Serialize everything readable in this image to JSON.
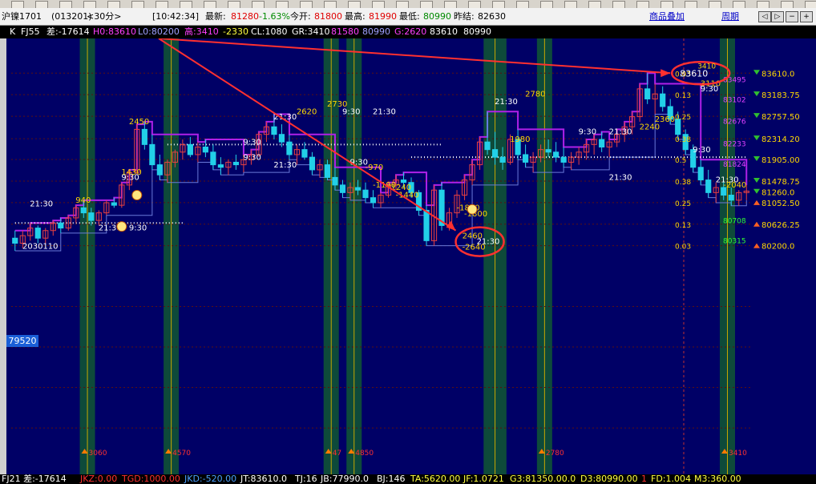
{
  "quote_bar": {
    "symbol": "沪镍1701",
    "code": "(013201)",
    "period": "<30分>",
    "time": "[10:42:34]",
    "latest_label": "最新:",
    "latest": "81280",
    "change": "-1.63%",
    "open_label": "今开:",
    "open": "81800",
    "high_label": "最高:",
    "high": "81990",
    "low_label": "最低:",
    "low": "80990",
    "prev_close_label": "昨结:",
    "prev_close": "82630",
    "overlay_link": "商品叠加",
    "period_link": "周期"
  },
  "indicator_bar": {
    "k": "K",
    "name": "FJ55",
    "diff": "差:-17614",
    "h0": "H0:83610",
    "l0": "L0:80200",
    "high": "高:3410",
    "neg": "-2330",
    "cl": "CL:1080",
    "gr": "GR:3410",
    "v1": "81580",
    "v2": "80990",
    "g": "G:2620",
    "v3": "83610",
    "v4": "80990"
  },
  "status_bar": {
    "a": "FJ21 差:-17614",
    "b": "JKZ:0.00",
    "c": "TGD:1000.00",
    "d": "JKD:-520.00",
    "e": "JT:83610.0",
    "f": "TJ:16",
    "g": "JB:77990.0",
    "h": "BJ:146",
    "i": "TA:5620.00",
    "j": "JF:1.0721",
    "k": "G3:81350.00.0",
    "l": "D3:80990.00",
    "m": "1",
    "n": "FD:1.004",
    "o": "M3:360.00"
  },
  "highlight_price": "79520",
  "colors": {
    "bg": "#000066",
    "up": "#e84040",
    "down": "#22d0e8",
    "purple": "#b020e8",
    "zone": "#0e4a3a",
    "annot": "#ff3030",
    "yellow": "#ffd700",
    "white": "#ffffff",
    "green": "#30ff30"
  },
  "chart_data": {
    "type": "candlestick",
    "ylim": [
      76000,
      84200
    ],
    "right_axis": [
      {
        "value": 83610,
        "label": "83610.0",
        "arrow": "down"
      },
      {
        "value": 83184,
        "label": "83183.75",
        "arrow": "down"
      },
      {
        "value": 82758,
        "label": "82757.50",
        "arrow": "down"
      },
      {
        "value": 82314,
        "label": "82314.20",
        "arrow": "down"
      },
      {
        "value": 81905,
        "label": "81905.00",
        "arrow": "down"
      },
      {
        "value": 81478,
        "label": "81478.75",
        "arrow": "down"
      },
      {
        "value": 81260,
        "label": "81260.0",
        "arrow": "down"
      },
      {
        "value": 81052,
        "label": "81052.50",
        "arrow": "up"
      },
      {
        "value": 80626,
        "label": "80626.25",
        "arrow": "up"
      },
      {
        "value": 80200,
        "label": "80200.0",
        "arrow": "up"
      }
    ],
    "fib_levels": [
      {
        "value": 83610,
        "label": "0.03"
      },
      {
        "value": 83184,
        "label": "0.13"
      },
      {
        "value": 82758,
        "label": "0.25"
      },
      {
        "value": 82314,
        "label": "0.38"
      },
      {
        "value": 81905,
        "label": "0.5"
      },
      {
        "value": 81478,
        "label": "0.38"
      },
      {
        "value": 81052,
        "label": "0.25"
      },
      {
        "value": 80626,
        "label": "0.13"
      },
      {
        "value": 80200,
        "label": "0.03"
      }
    ],
    "side_values": [
      {
        "value": 83495,
        "label": "83495",
        "color": "purple"
      },
      {
        "value": 83102,
        "label": "83102",
        "color": "purple"
      },
      {
        "value": 82676,
        "label": "82676",
        "color": "purple"
      },
      {
        "value": 82233,
        "label": "82233",
        "color": "purple"
      },
      {
        "value": 81824,
        "label": "81824",
        "color": "purple"
      },
      {
        "value": 80708,
        "label": "80708",
        "color": "green"
      },
      {
        "value": 80315,
        "label": "80315",
        "color": "green"
      }
    ],
    "candles": [
      {
        "o": 80350,
        "h": 80500,
        "l": 80100,
        "c": 80250
      },
      {
        "o": 80250,
        "h": 80500,
        "l": 80150,
        "c": 80400
      },
      {
        "o": 80400,
        "h": 80650,
        "l": 80300,
        "c": 80550
      },
      {
        "o": 80550,
        "h": 80600,
        "l": 80250,
        "c": 80350
      },
      {
        "o": 80350,
        "h": 80550,
        "l": 80250,
        "c": 80500
      },
      {
        "o": 80500,
        "h": 80700,
        "l": 80400,
        "c": 80650
      },
      {
        "o": 80650,
        "h": 80750,
        "l": 80450,
        "c": 80550
      },
      {
        "o": 80550,
        "h": 80800,
        "l": 80500,
        "c": 80750
      },
      {
        "o": 80750,
        "h": 81000,
        "l": 80650,
        "c": 80950
      },
      {
        "o": 80950,
        "h": 81100,
        "l": 80750,
        "c": 80850
      },
      {
        "o": 80850,
        "h": 80950,
        "l": 80600,
        "c": 80700
      },
      {
        "o": 80700,
        "h": 80900,
        "l": 80600,
        "c": 80850
      },
      {
        "o": 80850,
        "h": 81100,
        "l": 80800,
        "c": 81050
      },
      {
        "o": 81050,
        "h": 81150,
        "l": 80950,
        "c": 81000
      },
      {
        "o": 81000,
        "h": 81450,
        "l": 80950,
        "c": 81400
      },
      {
        "o": 81400,
        "h": 81700,
        "l": 81300,
        "c": 81650
      },
      {
        "o": 81650,
        "h": 82600,
        "l": 81600,
        "c": 82500
      },
      {
        "o": 82500,
        "h": 82650,
        "l": 82100,
        "c": 82200
      },
      {
        "o": 82200,
        "h": 82400,
        "l": 81700,
        "c": 81800
      },
      {
        "o": 81800,
        "h": 82000,
        "l": 81500,
        "c": 81600
      },
      {
        "o": 81600,
        "h": 81900,
        "l": 81450,
        "c": 81850
      },
      {
        "o": 81850,
        "h": 82100,
        "l": 81750,
        "c": 82050
      },
      {
        "o": 82050,
        "h": 82300,
        "l": 81900,
        "c": 82200
      },
      {
        "o": 82200,
        "h": 82350,
        "l": 81950,
        "c": 82000
      },
      {
        "o": 82000,
        "h": 82250,
        "l": 81850,
        "c": 82150
      },
      {
        "o": 82150,
        "h": 82300,
        "l": 81950,
        "c": 82050
      },
      {
        "o": 82050,
        "h": 82200,
        "l": 81700,
        "c": 81800
      },
      {
        "o": 81800,
        "h": 81950,
        "l": 81600,
        "c": 81750
      },
      {
        "o": 81750,
        "h": 81900,
        "l": 81600,
        "c": 81850
      },
      {
        "o": 81850,
        "h": 82000,
        "l": 81700,
        "c": 81800
      },
      {
        "o": 81800,
        "h": 82000,
        "l": 81650,
        "c": 81900
      },
      {
        "o": 81900,
        "h": 82100,
        "l": 81800,
        "c": 82000
      },
      {
        "o": 82000,
        "h": 82450,
        "l": 81950,
        "c": 82400
      },
      {
        "o": 82400,
        "h": 82650,
        "l": 82250,
        "c": 82550
      },
      {
        "o": 82550,
        "h": 82800,
        "l": 82300,
        "c": 82400
      },
      {
        "o": 82400,
        "h": 82600,
        "l": 82150,
        "c": 82250
      },
      {
        "o": 82250,
        "h": 82400,
        "l": 81900,
        "c": 82000
      },
      {
        "o": 82000,
        "h": 82200,
        "l": 81800,
        "c": 82100
      },
      {
        "o": 82100,
        "h": 82250,
        "l": 81900,
        "c": 81950
      },
      {
        "o": 81950,
        "h": 82050,
        "l": 81600,
        "c": 81700
      },
      {
        "o": 81700,
        "h": 81900,
        "l": 81550,
        "c": 81800
      },
      {
        "o": 81800,
        "h": 81900,
        "l": 81500,
        "c": 81550
      },
      {
        "o": 81550,
        "h": 81750,
        "l": 81300,
        "c": 81400
      },
      {
        "o": 81400,
        "h": 81500,
        "l": 81150,
        "c": 81250
      },
      {
        "o": 81250,
        "h": 81450,
        "l": 81100,
        "c": 81350
      },
      {
        "o": 81350,
        "h": 81500,
        "l": 81200,
        "c": 81300
      },
      {
        "o": 81300,
        "h": 81450,
        "l": 81050,
        "c": 81150
      },
      {
        "o": 81150,
        "h": 81300,
        "l": 80950,
        "c": 81050
      },
      {
        "o": 81050,
        "h": 81250,
        "l": 80950,
        "c": 81200
      },
      {
        "o": 81200,
        "h": 81450,
        "l": 81150,
        "c": 81400
      },
      {
        "o": 81400,
        "h": 81600,
        "l": 81300,
        "c": 81500
      },
      {
        "o": 81500,
        "h": 81650,
        "l": 81350,
        "c": 81450
      },
      {
        "o": 81450,
        "h": 81550,
        "l": 81150,
        "c": 81250
      },
      {
        "o": 81250,
        "h": 81300,
        "l": 80800,
        "c": 80900
      },
      {
        "o": 80900,
        "h": 81000,
        "l": 80200,
        "c": 80300
      },
      {
        "o": 80300,
        "h": 81400,
        "l": 80200,
        "c": 81300
      },
      {
        "o": 81300,
        "h": 81450,
        "l": 80500,
        "c": 80600
      },
      {
        "o": 80600,
        "h": 80950,
        "l": 80500,
        "c": 80850
      },
      {
        "o": 80850,
        "h": 81300,
        "l": 80750,
        "c": 81200
      },
      {
        "o": 81200,
        "h": 81600,
        "l": 81100,
        "c": 81500
      },
      {
        "o": 81500,
        "h": 81900,
        "l": 81400,
        "c": 81800
      },
      {
        "o": 81800,
        "h": 82350,
        "l": 81700,
        "c": 82250
      },
      {
        "o": 82250,
        "h": 82850,
        "l": 82000,
        "c": 82100
      },
      {
        "o": 82100,
        "h": 82450,
        "l": 81800,
        "c": 81950
      },
      {
        "o": 81950,
        "h": 82150,
        "l": 81700,
        "c": 81850
      },
      {
        "o": 81850,
        "h": 82400,
        "l": 81800,
        "c": 82300
      },
      {
        "o": 82300,
        "h": 82500,
        "l": 81900,
        "c": 82000
      },
      {
        "o": 82000,
        "h": 82200,
        "l": 81750,
        "c": 81850
      },
      {
        "o": 81850,
        "h": 82050,
        "l": 81650,
        "c": 81950
      },
      {
        "o": 81950,
        "h": 82200,
        "l": 81850,
        "c": 82100
      },
      {
        "o": 82100,
        "h": 82300,
        "l": 81950,
        "c": 82050
      },
      {
        "o": 82050,
        "h": 82250,
        "l": 81850,
        "c": 81950
      },
      {
        "o": 81950,
        "h": 82150,
        "l": 81750,
        "c": 81850
      },
      {
        "o": 81850,
        "h": 82050,
        "l": 81700,
        "c": 81950
      },
      {
        "o": 81950,
        "h": 82150,
        "l": 81800,
        "c": 82050
      },
      {
        "o": 82050,
        "h": 82300,
        "l": 81900,
        "c": 82200
      },
      {
        "o": 82200,
        "h": 82400,
        "l": 82000,
        "c": 82300
      },
      {
        "o": 82300,
        "h": 82450,
        "l": 82050,
        "c": 82150
      },
      {
        "o": 82150,
        "h": 82300,
        "l": 81950,
        "c": 82250
      },
      {
        "o": 82250,
        "h": 82500,
        "l": 82150,
        "c": 82400
      },
      {
        "o": 82400,
        "h": 82650,
        "l": 82250,
        "c": 82550
      },
      {
        "o": 82550,
        "h": 82850,
        "l": 82400,
        "c": 82750
      },
      {
        "o": 82750,
        "h": 83400,
        "l": 82650,
        "c": 83300
      },
      {
        "o": 83300,
        "h": 83610,
        "l": 83000,
        "c": 83100
      },
      {
        "o": 83100,
        "h": 83400,
        "l": 82800,
        "c": 83200
      },
      {
        "o": 83200,
        "h": 83350,
        "l": 82850,
        "c": 82950
      },
      {
        "o": 82950,
        "h": 83100,
        "l": 82600,
        "c": 82700
      },
      {
        "o": 82700,
        "h": 82850,
        "l": 82300,
        "c": 82400
      },
      {
        "o": 82400,
        "h": 82500,
        "l": 82000,
        "c": 82100
      },
      {
        "o": 82100,
        "h": 82200,
        "l": 81650,
        "c": 81750
      },
      {
        "o": 81750,
        "h": 81900,
        "l": 81400,
        "c": 81500
      },
      {
        "o": 81500,
        "h": 81700,
        "l": 81150,
        "c": 81250
      },
      {
        "o": 81250,
        "h": 81450,
        "l": 81050,
        "c": 81350
      },
      {
        "o": 81350,
        "h": 81500,
        "l": 81100,
        "c": 81200
      },
      {
        "o": 81200,
        "h": 81350,
        "l": 80990,
        "c": 81100
      },
      {
        "o": 81100,
        "h": 81300,
        "l": 80990,
        "c": 81250
      },
      {
        "o": 81250,
        "h": 81400,
        "l": 81100,
        "c": 81280
      }
    ],
    "zones": [
      {
        "from": 9,
        "to": 10,
        "marker": "3060"
      },
      {
        "from": 20,
        "to": 21,
        "marker": "4570"
      },
      {
        "from": 41,
        "to": 42,
        "marker": "47"
      },
      {
        "from": 44,
        "to": 45,
        "marker": "4850"
      },
      {
        "from": 62,
        "to": 64,
        "marker": ""
      },
      {
        "from": 69,
        "to": 70,
        "marker": "2780"
      },
      {
        "from": 93,
        "to": 94,
        "marker": "3410"
      }
    ],
    "annotations": [
      {
        "text": "21:30",
        "i": 3,
        "y": 80980,
        "color": "white"
      },
      {
        "text": "940",
        "i": 9,
        "y": 81050,
        "color": "yellow"
      },
      {
        "text": "21:30",
        "i": 12,
        "y": 80500,
        "color": "white"
      },
      {
        "text": "9:30",
        "i": 16,
        "y": 80500,
        "color": "white"
      },
      {
        "text": "1430",
        "i": 15,
        "y": 81600,
        "color": "yellow"
      },
      {
        "text": "9:30",
        "i": 15,
        "y": 81500,
        "color": "white"
      },
      {
        "text": "2450",
        "i": 16,
        "y": 82600,
        "color": "yellow"
      },
      {
        "text": "9:30",
        "i": 31,
        "y": 82200,
        "color": "white"
      },
      {
        "text": "9:30",
        "i": 31,
        "y": 81900,
        "color": "white"
      },
      {
        "text": "21:30",
        "i": 35,
        "y": 81750,
        "color": "white"
      },
      {
        "text": "2620",
        "i": 38,
        "y": 82800,
        "color": "yellow"
      },
      {
        "text": "21:30",
        "i": 35,
        "y": 82700,
        "color": "white"
      },
      {
        "text": "2730",
        "i": 42,
        "y": 82950,
        "color": "yellow"
      },
      {
        "text": "9:30",
        "i": 44,
        "y": 82800,
        "color": "white"
      },
      {
        "text": "21:30",
        "i": 48,
        "y": 82800,
        "color": "white"
      },
      {
        "text": "9:30",
        "i": 45,
        "y": 81800,
        "color": "white"
      },
      {
        "text": "-970",
        "i": 47,
        "y": 81700,
        "color": "yellow"
      },
      {
        "text": "-1190",
        "i": 48,
        "y": 81350,
        "color": "yellow"
      },
      {
        "text": "-1240",
        "i": 50,
        "y": 81300,
        "color": "yellow"
      },
      {
        "text": "-1440",
        "i": 51,
        "y": 81150,
        "color": "yellow"
      },
      {
        "text": "-1880",
        "i": 59,
        "y": 80900,
        "color": "yellow"
      },
      {
        "text": "-1800",
        "i": 60,
        "y": 80780,
        "color": "yellow"
      },
      {
        "text": "21:30",
        "i": 64,
        "y": 83000,
        "color": "white"
      },
      {
        "text": "1980",
        "i": 66,
        "y": 82250,
        "color": "yellow"
      },
      {
        "text": "2780",
        "i": 68,
        "y": 83150,
        "color": "yellow"
      },
      {
        "text": "9:30",
        "i": 75,
        "y": 82400,
        "color": "white"
      },
      {
        "text": "21:30",
        "i": 79,
        "y": 82400,
        "color": "white"
      },
      {
        "text": "21:30",
        "i": 79,
        "y": 81500,
        "color": "white"
      },
      {
        "text": "2240",
        "i": 83,
        "y": 82500,
        "color": "yellow"
      },
      {
        "text": "2360",
        "i": 85,
        "y": 82650,
        "color": "yellow"
      },
      {
        "text": "3110",
        "i": 91,
        "y": 83350,
        "color": "yellow"
      },
      {
        "text": "9:30",
        "i": 91,
        "y": 83250,
        "color": "white"
      },
      {
        "text": "9:30",
        "i": 90,
        "y": 82050,
        "color": "white"
      },
      {
        "text": "21:30",
        "i": 93,
        "y": 81450,
        "color": "white"
      },
      {
        "text": "-2040",
        "i": 94,
        "y": 81350,
        "color": "yellow"
      }
    ],
    "circled_top": {
      "text": "83610",
      "sub": "3410",
      "i": 90,
      "y": 83610
    },
    "circled_bottom": {
      "text": "2460",
      "sub": "-2640",
      "i": 61,
      "y": 80280
    },
    "highlight_time": "21:30",
    "bottom_time": "2030110"
  }
}
